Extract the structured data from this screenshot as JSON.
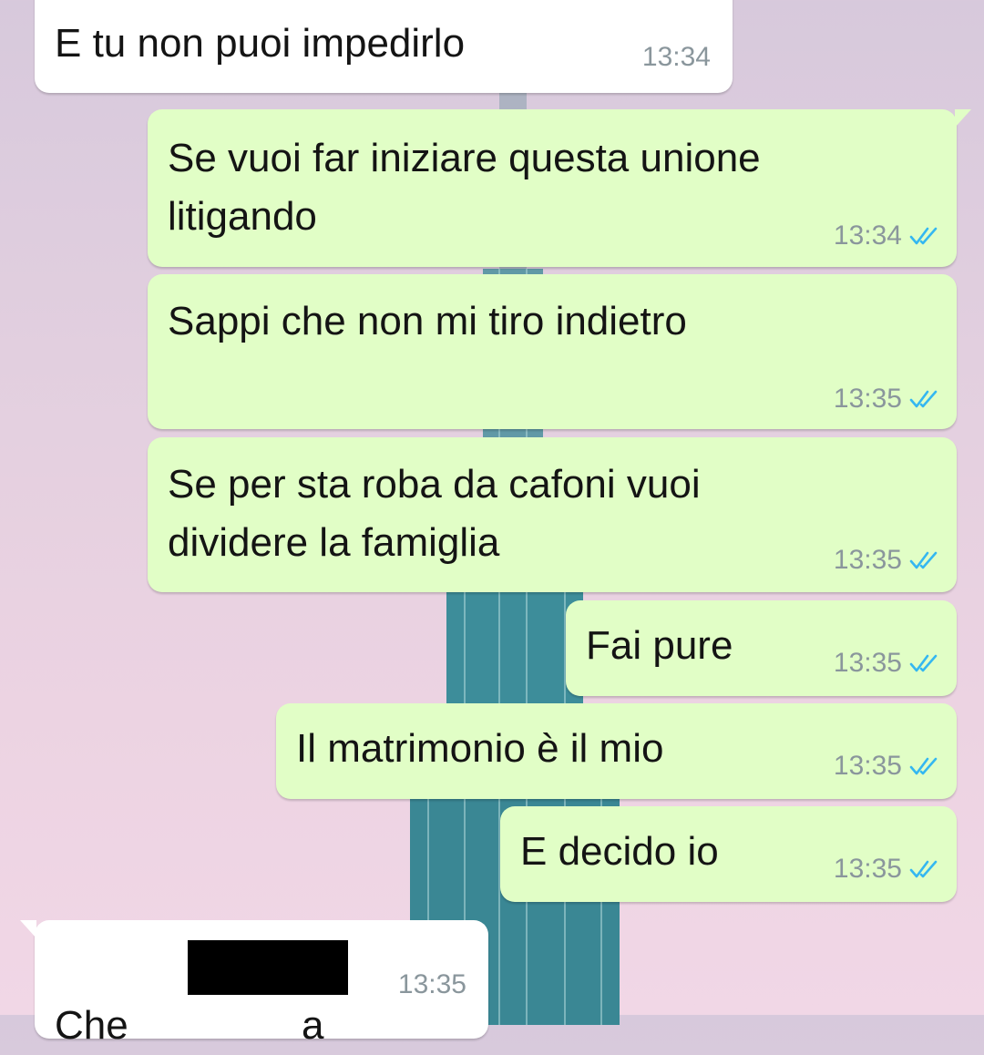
{
  "background": {
    "colors": {
      "sky_top": "#d7c9dc",
      "sky_bottom": "#f1d7e6",
      "tower": "#3d8d9a"
    }
  },
  "colors": {
    "incoming_bubble": "#ffffff",
    "outgoing_bubble": "#e1fec6",
    "text": "#141414",
    "timestamp": "#8a969c",
    "read_ticks": "#34b7f1"
  },
  "messages": [
    {
      "direction": "in",
      "text": "E tu non puoi impedirlo",
      "time": "13:34"
    },
    {
      "direction": "out",
      "text": "Se vuoi far iniziare questa unione\nlitigando",
      "time": "13:34",
      "status_icon": "double-check-read-icon"
    },
    {
      "direction": "out",
      "text": "Sappi che non mi tiro indietro",
      "time": "13:35",
      "status_icon": "double-check-read-icon"
    },
    {
      "direction": "out",
      "text": "Se per sta roba da cafoni vuoi\ndividere la famiglia",
      "time": "13:35",
      "status_icon": "double-check-read-icon"
    },
    {
      "direction": "out",
      "text": "Fai pure",
      "time": "13:35",
      "status_icon": "double-check-read-icon"
    },
    {
      "direction": "out",
      "text": "Il matrimonio è il mio",
      "time": "13:35",
      "status_icon": "double-check-read-icon"
    },
    {
      "direction": "out",
      "text": "E decido io",
      "time": "13:35",
      "status_icon": "double-check-read-icon"
    },
    {
      "direction": "in",
      "text": "Che ",
      "text_end": "a",
      "time": "13:35",
      "redacted": true
    }
  ]
}
